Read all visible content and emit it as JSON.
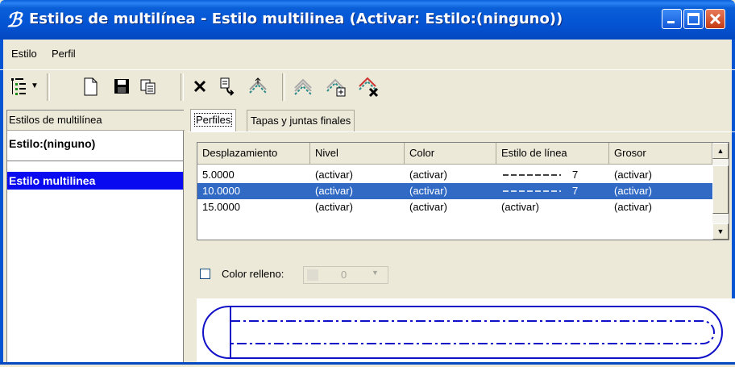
{
  "window": {
    "title": "Estilos de multilínea -  Estilo multilinea (Activar: Estilo:(ninguno))",
    "app_icon": "microstation-icon",
    "controls": [
      "minimize",
      "maximize",
      "close"
    ]
  },
  "menu": {
    "items": [
      {
        "label": "Estilo"
      },
      {
        "label": "Perfil"
      }
    ]
  },
  "toolbar": {
    "buttons": [
      "tree-view-icon",
      "dropdown-arrow-icon",
      "new-icon",
      "save-icon",
      "copy-icon",
      "delete-icon",
      "paste-icon",
      "upload-lines-icon",
      "multiline-icon",
      "add-multiline-icon",
      "delete-multiline-icon"
    ]
  },
  "left_panel": {
    "header": "Estilos de multilínea",
    "items": [
      {
        "label": "Estilo:(ninguno)"
      },
      {
        "label": "Estilo multilinea"
      }
    ]
  },
  "tabs": [
    {
      "label": "Perfiles"
    },
    {
      "label": "Tapas y juntas finales"
    }
  ],
  "table": {
    "columns": [
      "Desplazamiento",
      "Nivel",
      "Color",
      "Estilo de línea",
      "Grosor"
    ],
    "rows": [
      [
        "5.0000",
        "(activar)",
        "(activar)",
        "7",
        "(activar)"
      ],
      [
        "10.0000",
        "(activar)",
        "(activar)",
        "7",
        "(activar)"
      ],
      [
        "15.0000",
        "(activar)",
        "(activar)",
        "(activar)",
        "(activar)"
      ]
    ],
    "selected_row": 1
  },
  "fill": {
    "label": "Color relleno:",
    "checked": false,
    "color_value": "0"
  },
  "colors": {
    "title_bar": "#0454d4",
    "selection_left": "#0a0af0",
    "selection_table": "#316ac5",
    "preview_line": "#1010c8"
  }
}
